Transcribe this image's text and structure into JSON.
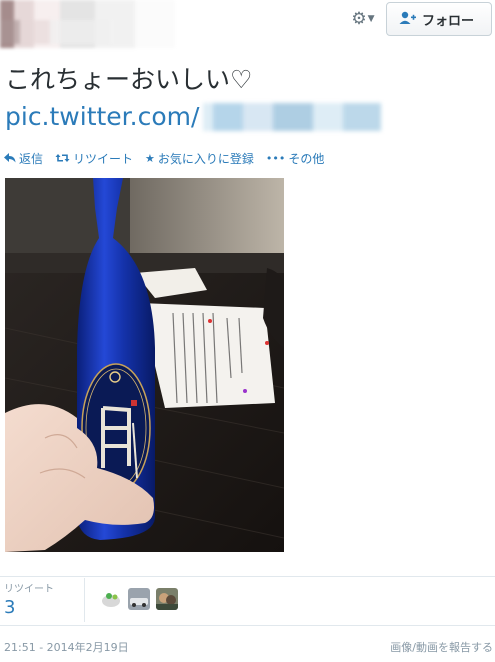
{
  "header": {
    "follow_label": "フォロー"
  },
  "tweet": {
    "text": "これちょーおいしい♡",
    "link_text": "pic.twitter.com/"
  },
  "actions": [
    {
      "label": "返信"
    },
    {
      "label": "リツイート"
    },
    {
      "label": "お気に入りに登録"
    },
    {
      "label": "その他"
    }
  ],
  "stats": {
    "retweets_label": "リツイート",
    "retweets_count": "3"
  },
  "footer": {
    "timestamp": "21:51 - 2014年2月19日",
    "report_label": "画像/動画を報告する"
  },
  "colors": {
    "link": "#2b7bb9",
    "text": "#292f33",
    "muted": "#8899a6"
  },
  "icons": [
    "settings-gear-icon",
    "chevron-down-icon",
    "follow-person-plus-icon",
    "reply-icon",
    "retweet-icon",
    "favorite-star-icon",
    "more-dots-icon"
  ]
}
